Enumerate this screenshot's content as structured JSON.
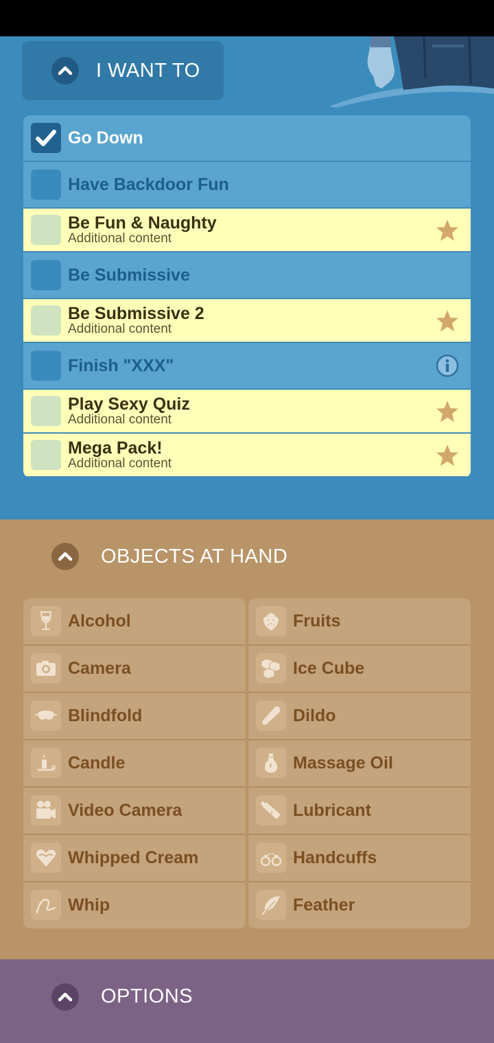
{
  "colors": {
    "want_bg": "#3b8cbc",
    "objects_bg": "#b89468",
    "options_bg": "#7c6386",
    "premium_row": "#ffffb9"
  },
  "want_section": {
    "title": "I WANT TO",
    "toggle_icon": "chevron-up-icon",
    "items": [
      {
        "label": "Go Down",
        "checked": true
      },
      {
        "label": "Have Backdoor Fun",
        "checked": false
      },
      {
        "label": "Be Fun & Naughty",
        "sub": "Additional content",
        "badge": "star-icon"
      },
      {
        "label": "Be Submissive",
        "checked": false
      },
      {
        "label": "Be Submissive 2",
        "sub": "Additional content",
        "badge": "star-icon"
      },
      {
        "label": "Finish \"XXX\"",
        "checked": false,
        "badge": "info-icon"
      },
      {
        "label": "Play Sexy Quiz",
        "sub": "Additional content",
        "badge": "star-icon"
      },
      {
        "label": "Mega Pack!",
        "sub": "Additional content",
        "badge": "star-icon"
      }
    ]
  },
  "objects_section": {
    "title": "OBJECTS AT HAND",
    "toggle_icon": "chevron-up-icon",
    "left": [
      {
        "label": "Alcohol",
        "icon": "wine-glass-icon"
      },
      {
        "label": "Camera",
        "icon": "camera-icon"
      },
      {
        "label": "Blindfold",
        "icon": "blindfold-icon"
      },
      {
        "label": "Candle",
        "icon": "candle-icon"
      },
      {
        "label": "Video Camera",
        "icon": "video-camera-icon"
      },
      {
        "label": "Whipped Cream",
        "icon": "whipped-cream-icon"
      },
      {
        "label": "Whip",
        "icon": "whip-icon"
      }
    ],
    "right": [
      {
        "label": "Fruits",
        "icon": "strawberry-icon"
      },
      {
        "label": "Ice Cube",
        "icon": "ice-cube-icon"
      },
      {
        "label": "Dildo",
        "icon": "dildo-icon"
      },
      {
        "label": "Massage Oil",
        "icon": "oil-bottle-icon"
      },
      {
        "label": "Lubricant",
        "icon": "lubricant-tube-icon"
      },
      {
        "label": "Handcuffs",
        "icon": "handcuffs-icon"
      },
      {
        "label": "Feather",
        "icon": "feather-icon"
      }
    ]
  },
  "options_section": {
    "title": "OPTIONS",
    "toggle_icon": "chevron-up-icon"
  }
}
